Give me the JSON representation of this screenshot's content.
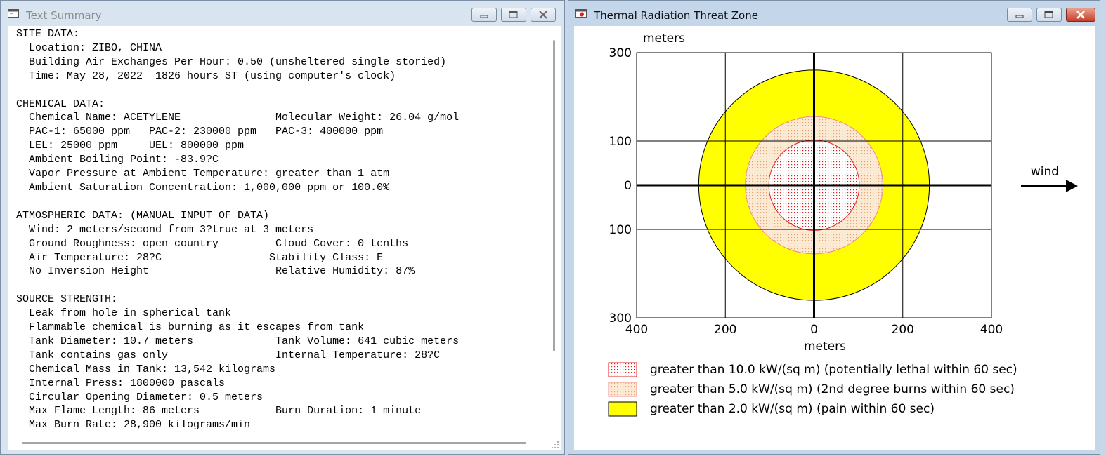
{
  "text_window": {
    "title": "Text Summary",
    "lines": [
      "SITE DATA:",
      "  Location: ZIBO, CHINA",
      "  Building Air Exchanges Per Hour: 0.50 (unsheltered single storied)",
      "  Time: May 28, 2022  1826 hours ST (using computer's clock)",
      "",
      "CHEMICAL DATA:",
      "  Chemical Name: ACETYLENE               Molecular Weight: 26.04 g/mol",
      "  PAC-1: 65000 ppm   PAC-2: 230000 ppm   PAC-3: 400000 ppm",
      "  LEL: 25000 ppm     UEL: 800000 ppm",
      "  Ambient Boiling Point: -83.9?C",
      "  Vapor Pressure at Ambient Temperature: greater than 1 atm",
      "  Ambient Saturation Concentration: 1,000,000 ppm or 100.0%",
      "",
      "ATMOSPHERIC DATA: (MANUAL INPUT OF DATA)",
      "  Wind: 2 meters/second from 3?true at 3 meters",
      "  Ground Roughness: open country         Cloud Cover: 0 tenths",
      "  Air Temperature: 28?C                 Stability Class: E",
      "  No Inversion Height                    Relative Humidity: 87%",
      "",
      "SOURCE STRENGTH:",
      "  Leak from hole in spherical tank",
      "  Flammable chemical is burning as it escapes from tank",
      "  Tank Diameter: 10.7 meters             Tank Volume: 641 cubic meters",
      "  Tank contains gas only                 Internal Temperature: 28?C",
      "  Chemical Mass in Tank: 13,542 kilograms",
      "  Internal Press: 1800000 pascals",
      "  Circular Opening Diameter: 0.5 meters",
      "  Max Flame Length: 86 meters            Burn Duration: 1 minute",
      "  Max Burn Rate: 28,900 kilograms/min"
    ]
  },
  "threat_window": {
    "title": "Thermal Radiation Threat Zone"
  },
  "chart_data": {
    "type": "threat-zone-plot",
    "y_unit_label": "meters",
    "x_unit_label": "meters",
    "y_ticks": [
      "300",
      "100",
      "0",
      "100",
      "300"
    ],
    "x_ticks": [
      "400",
      "200",
      "0",
      "200",
      "400"
    ],
    "xlim": [
      -400,
      400
    ],
    "ylim": [
      -300,
      300
    ],
    "wind_label": "wind",
    "zones": [
      {
        "label": "greater than 2.0 kW/(sq m) (pain within 60 sec)",
        "radius_m": 260,
        "fill": "#ffff00",
        "stroke": "#000000"
      },
      {
        "label": "greater than 5.0 kW/(sq m) (2nd degree burns within 60 sec)",
        "radius_m": 155,
        "fill": "#fbe7cc",
        "stroke": "#f08a8a",
        "pattern": "orange-dots"
      },
      {
        "label": "greater than 10.0 kW/(sq m) (potentially lethal within 60 sec)",
        "radius_m": 102,
        "fill": "#ffffff",
        "stroke": "#e02020",
        "pattern": "red-dots"
      }
    ],
    "legend": [
      "greater than 10.0 kW/(sq m) (potentially lethal within 60 sec)",
      "greater than 5.0 kW/(sq m) (2nd degree burns within 60 sec)",
      "greater than 2.0 kW/(sq m) (pain within 60 sec)"
    ],
    "colors": {
      "yellow": "#ffff00",
      "orange_dot": "#f0a070",
      "red_dot": "#e02020",
      "red_line": "#e02020"
    }
  }
}
